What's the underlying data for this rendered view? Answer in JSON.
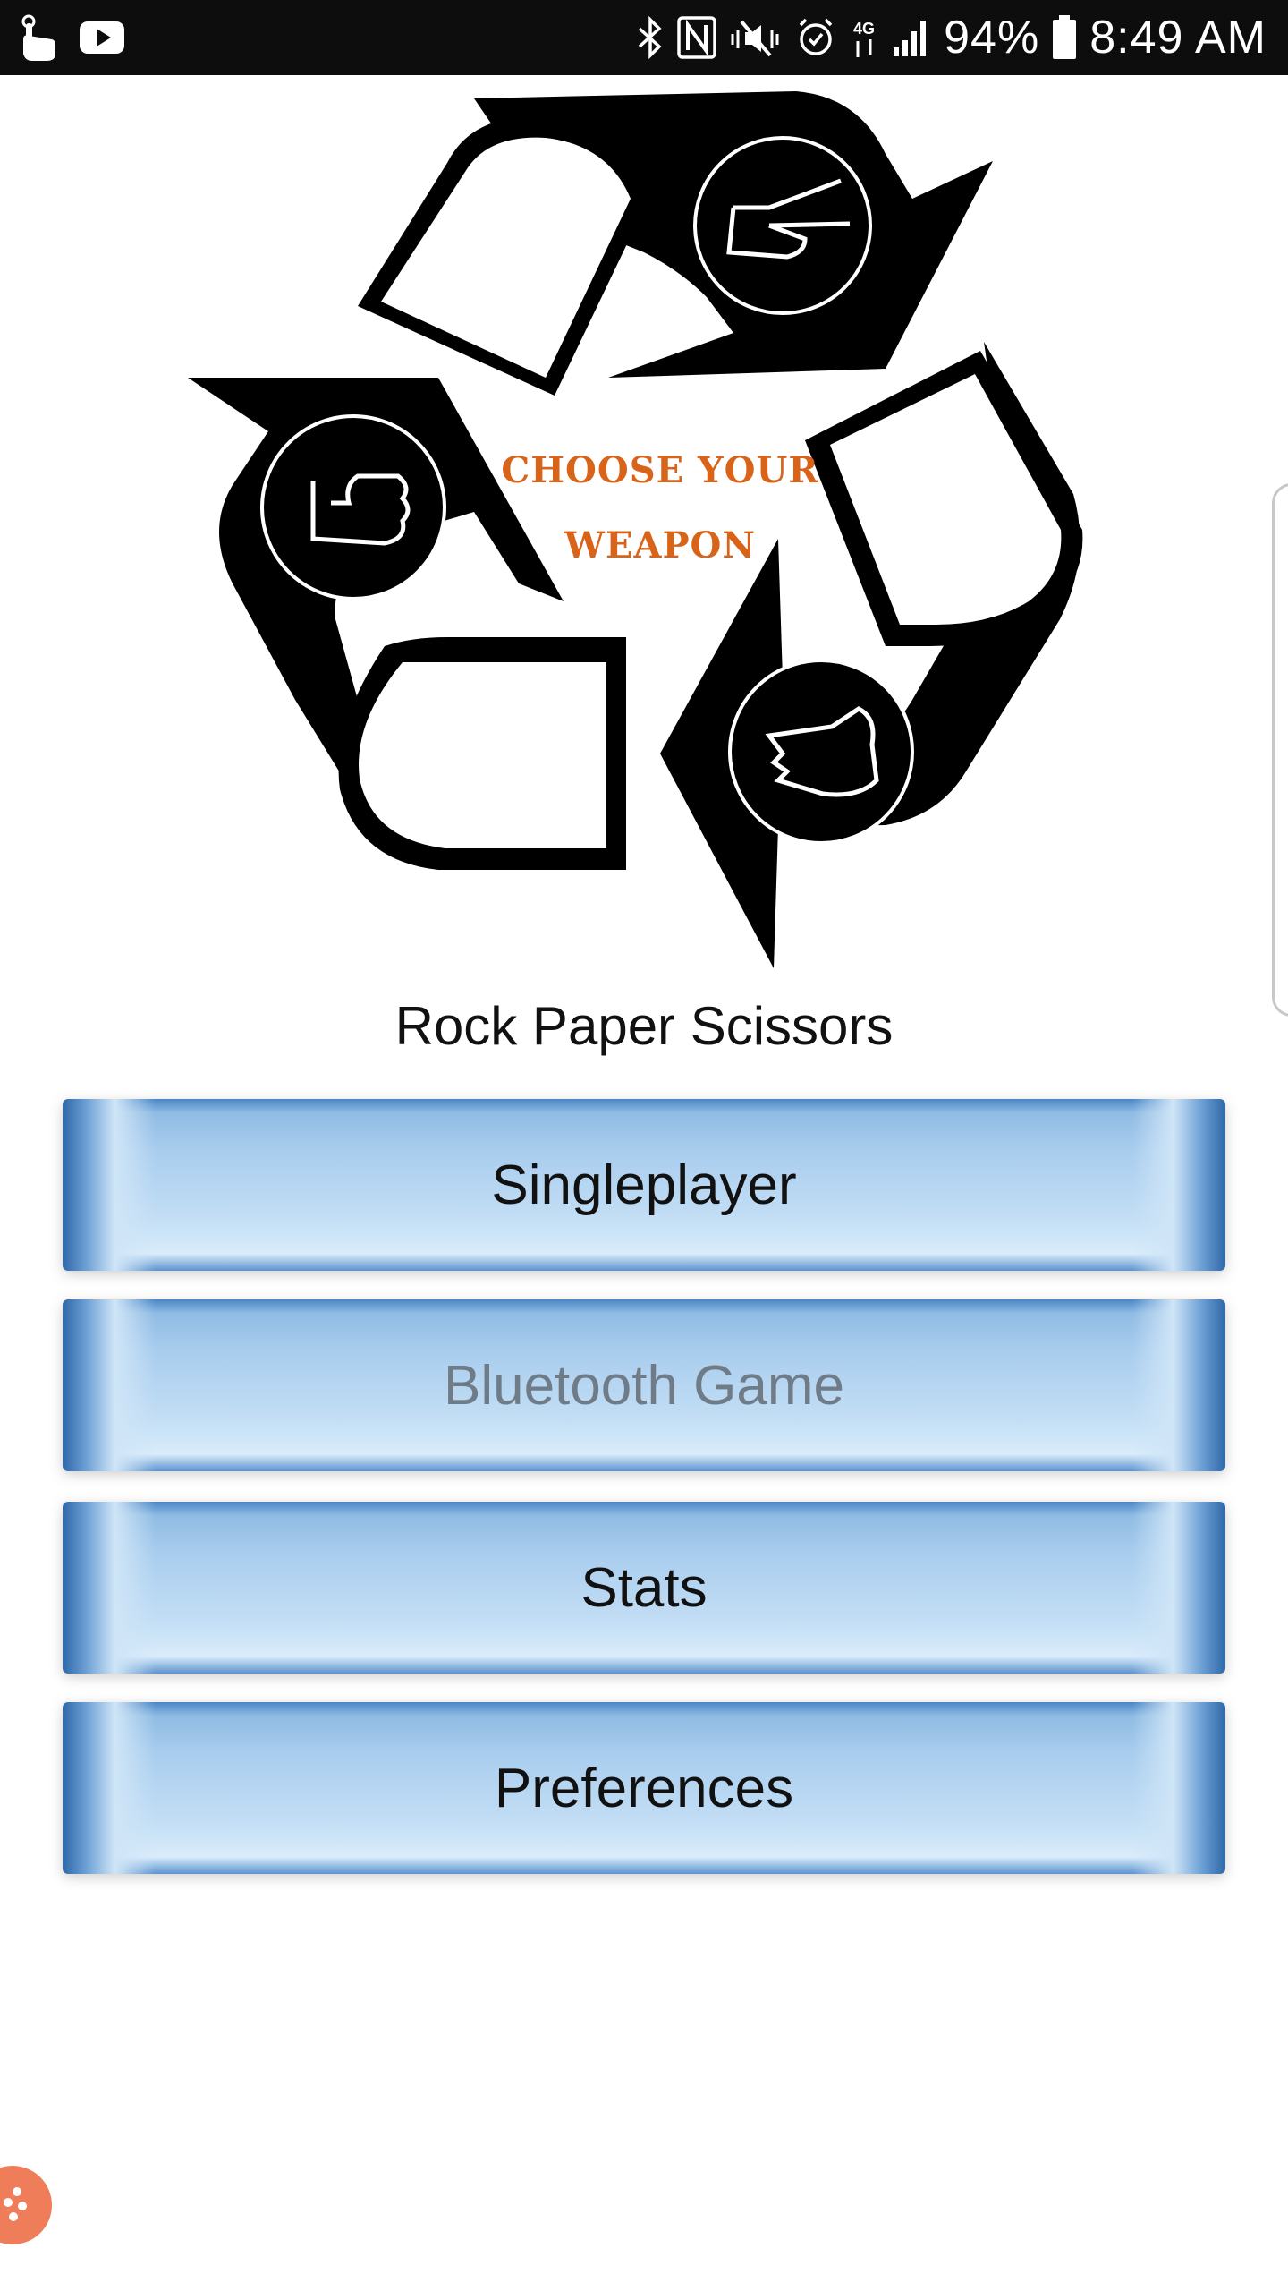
{
  "status_bar": {
    "battery_percent": "94%",
    "time": "8:49 AM",
    "icons_left": [
      "touch-gesture-icon",
      "youtube-icon"
    ],
    "icons_right": [
      "bluetooth-icon",
      "nfc-icon",
      "mute-icon",
      "alarm-icon",
      "data-transfer-icon",
      "signal-icon",
      "battery-icon"
    ]
  },
  "logo": {
    "line1": "CHOOSE YOUR",
    "line2": "WEAPON",
    "icons": [
      "scissors-hand-icon",
      "rock-fist-icon",
      "paper-hand-icon"
    ],
    "caption_color": "#d8641a"
  },
  "app_title": "Rock Paper Scissors",
  "menu": {
    "singleplayer": "Singleplayer",
    "bluetooth_game": "Bluetooth Game",
    "stats": "Stats",
    "preferences": "Preferences"
  },
  "colors": {
    "button_blue_dark": "#2f67a8",
    "button_blue_light": "#d9ecfb",
    "disabled_text": "#6f7b86",
    "status_bar_bg": "#0d0d0d",
    "floating_bubble": "#f07d5a"
  }
}
